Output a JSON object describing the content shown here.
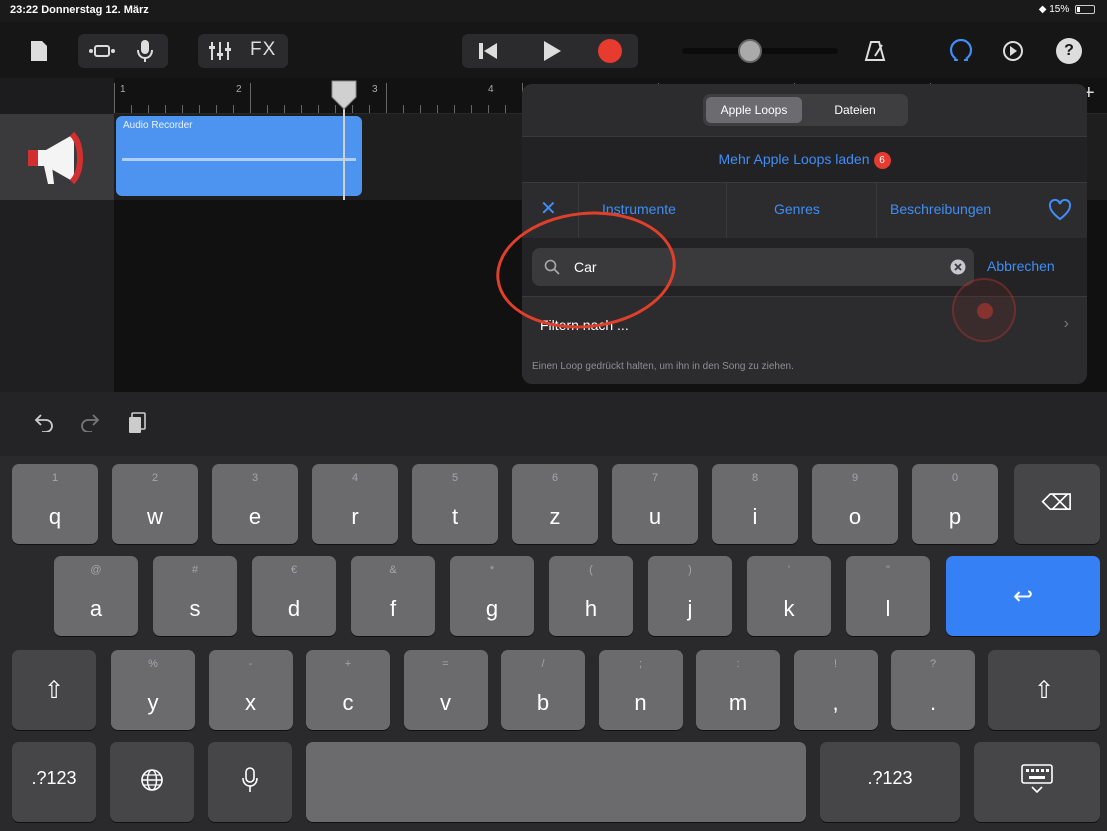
{
  "status": {
    "time_date": "23:22  Donnerstag 12. März",
    "battery": "15%"
  },
  "toolbar": {
    "fx_label": "FX",
    "help_label": "?"
  },
  "ruler": {
    "bars": [
      "1",
      "2",
      "3",
      "4"
    ]
  },
  "track": {
    "region_name": "Audio Recorder"
  },
  "browser": {
    "tabs": [
      "Apple Loops",
      "Dateien"
    ],
    "more_loops": "Mehr Apple Loops laden",
    "badge_count": "6",
    "categories": [
      "Instrumente",
      "Genres",
      "Beschreibungen"
    ],
    "search_value": "Car",
    "cancel": "Abbrechen",
    "filter": "Filtern nach ...",
    "hint": "Einen Loop gedrückt halten, um ihn in den Song zu ziehen."
  },
  "keyboard": {
    "row1": [
      {
        "main": "q",
        "sub": "1"
      },
      {
        "main": "w",
        "sub": "2"
      },
      {
        "main": "e",
        "sub": "3"
      },
      {
        "main": "r",
        "sub": "4"
      },
      {
        "main": "t",
        "sub": "5"
      },
      {
        "main": "z",
        "sub": "6"
      },
      {
        "main": "u",
        "sub": "7"
      },
      {
        "main": "i",
        "sub": "8"
      },
      {
        "main": "o",
        "sub": "9"
      },
      {
        "main": "p",
        "sub": "0"
      }
    ],
    "row2": [
      {
        "main": "a",
        "sub": "@"
      },
      {
        "main": "s",
        "sub": "#"
      },
      {
        "main": "d",
        "sub": "€"
      },
      {
        "main": "f",
        "sub": "&"
      },
      {
        "main": "g",
        "sub": "*"
      },
      {
        "main": "h",
        "sub": "("
      },
      {
        "main": "j",
        "sub": ")"
      },
      {
        "main": "k",
        "sub": "’"
      },
      {
        "main": "l",
        "sub": "\""
      }
    ],
    "row3": [
      {
        "main": "y",
        "sub": "%"
      },
      {
        "main": "x",
        "sub": "-"
      },
      {
        "main": "c",
        "sub": "+"
      },
      {
        "main": "v",
        "sub": "="
      },
      {
        "main": "b",
        "sub": "/"
      },
      {
        "main": "n",
        "sub": ";"
      },
      {
        "main": "m",
        "sub": ":"
      },
      {
        "main": ",",
        "sub": "!"
      },
      {
        "main": ".",
        "sub": "?"
      }
    ],
    "numbers_label": ".?123",
    "backspace_glyph": "⌫",
    "return_glyph": "↩",
    "shift_glyph": "⇧"
  },
  "colors": {
    "accent": "#3f8ef5",
    "record": "#e63b2e",
    "annotation": "#e0402b"
  }
}
